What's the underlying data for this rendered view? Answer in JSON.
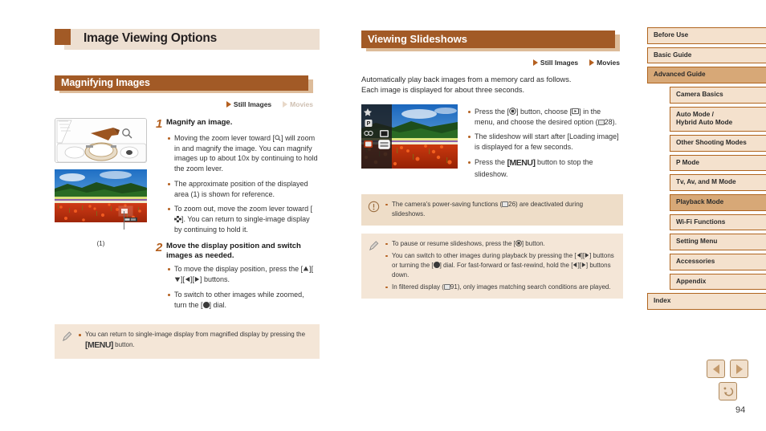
{
  "page": {
    "number": "94"
  },
  "left": {
    "page_title": "Image Viewing Options",
    "section_title": "Magnifying Images",
    "badges": [
      {
        "label": "Still Images",
        "active": true
      },
      {
        "label": "Movies",
        "active": false
      }
    ],
    "figure_caption": "(1)",
    "steps": [
      {
        "num": "1",
        "title": "Magnify an image.",
        "bullets": [
          "Moving the zoom lever toward [Q] will zoom in and magnify the image. You can magnify images up to about 10x by continuing to hold the zoom lever.",
          "The approximate position of the displayed area (1) is shown for reference.",
          "To zoom out, move the zoom lever toward []. You can return to single-image display by continuing to hold it."
        ]
      },
      {
        "num": "2",
        "title": "Move the display position and switch images as needed.",
        "bullets": [
          "To move the display position, press the [][][][] buttons.",
          "To switch to other images while zoomed, turn the [] dial."
        ]
      }
    ],
    "note": {
      "icon": "pencil-note-icon",
      "items": [
        "You can return to single-image display from magnified display by pressing the MENU button."
      ]
    }
  },
  "middle": {
    "section_title": "Viewing Slideshows",
    "badges": [
      {
        "label": "Still Images",
        "active": true
      },
      {
        "label": "Movies",
        "active": true
      }
    ],
    "intro_line1": "Automatically play back images from a memory card as follows.",
    "intro_line2": "Each image is displayed for about three seconds.",
    "bullets": [
      "Press the [] button, choose [] in the menu, and choose the desired option (28).",
      "The slideshow will start after [Loading image] is displayed for a few seconds.",
      "Press the MENU button to stop the slideshow."
    ],
    "warning": {
      "icon": "exclamation-icon",
      "items": [
        "The camera's power-saving functions (26) are deactivated during slideshows."
      ]
    },
    "note": {
      "icon": "pencil-note-icon",
      "items": [
        "To pause or resume slideshows, press the [] button.",
        "You can switch to other images during playback by pressing the [][] buttons or turning the [] dial. For fast-forward or fast-rewind, hold the [][] buttons down.",
        "In filtered display (91), only images matching search conditions are played."
      ]
    }
  },
  "sidebar": {
    "items": [
      {
        "label": "Before Use",
        "level": "top",
        "active": false
      },
      {
        "label": "Basic Guide",
        "level": "top",
        "active": false
      },
      {
        "label": "Advanced Guide",
        "level": "top",
        "active": true
      },
      {
        "label": "Camera Basics",
        "level": "sub",
        "active": false
      },
      {
        "label": "Auto Mode /\nHybrid Auto Mode",
        "level": "sub",
        "active": false
      },
      {
        "label": "Other Shooting Modes",
        "level": "sub",
        "active": false
      },
      {
        "label": "P Mode",
        "level": "sub",
        "active": false
      },
      {
        "label": "Tv, Av, and M Mode",
        "level": "sub",
        "active": false
      },
      {
        "label": "Playback Mode",
        "level": "sub",
        "active": true
      },
      {
        "label": "Wi-Fi Functions",
        "level": "sub",
        "active": false
      },
      {
        "label": "Setting Menu",
        "level": "sub",
        "active": false
      },
      {
        "label": "Accessories",
        "level": "sub",
        "active": false
      },
      {
        "label": "Appendix",
        "level": "sub",
        "active": false
      },
      {
        "label": "Index",
        "level": "top",
        "active": false
      }
    ]
  },
  "footer": {
    "prev_label": "previous-page",
    "next_label": "next-page",
    "back_label": "back"
  },
  "colors": {
    "accent_brown": "#a25a26",
    "accent_light": "#d7a877",
    "panel_beige": "#f4e1cd",
    "note_bg": "#f4e6d7",
    "warn_bg": "#eeddc8",
    "title_bg": "#eddfd1"
  }
}
